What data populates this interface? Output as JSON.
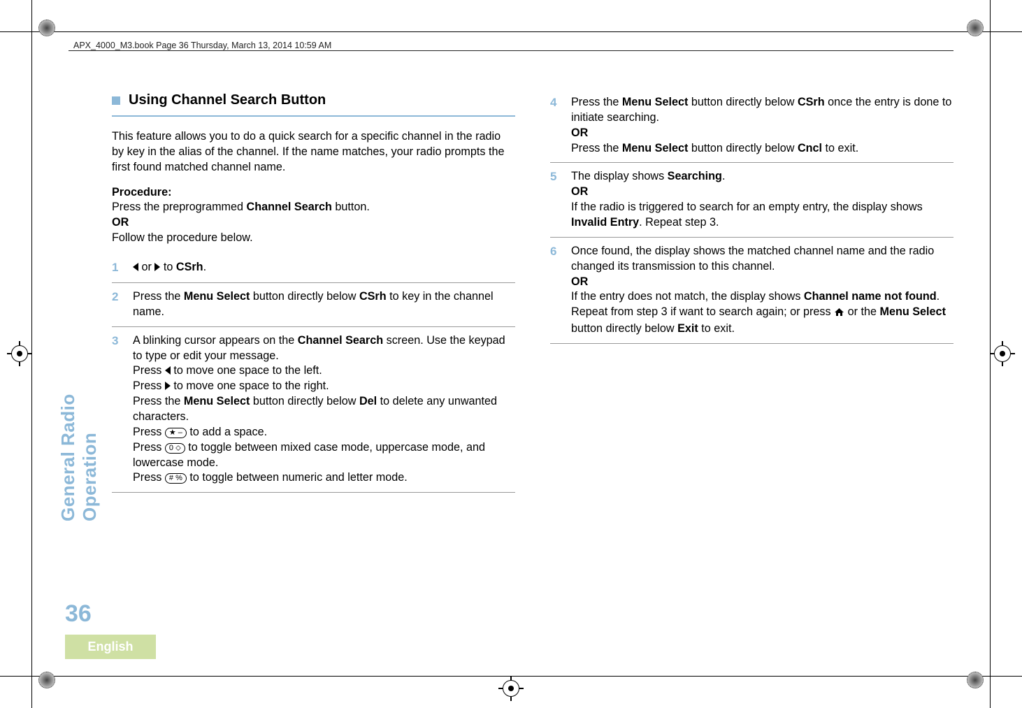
{
  "header": {
    "text": "APX_4000_M3.book  Page 36  Thursday, March 13, 2014  10:59 AM"
  },
  "sidebar": {
    "section": "General Radio Operation",
    "page": "36",
    "language": "English"
  },
  "left": {
    "title": "Using Channel Search Button",
    "intro": "This feature allows you to do a quick search for a specific channel in the radio by key in the alias of the channel. If the name matches, your radio prompts the first found matched channel name.",
    "procedure_label": "Procedure:",
    "procedure_line1a": "Press the preprogrammed ",
    "procedure_line1b": "Channel Search",
    "procedure_line1c": " button.",
    "or": "OR",
    "procedure_line2": "Follow the procedure below.",
    "step1_or": " or ",
    "step1_to": " to ",
    "step1_target": "CSrh",
    "step1_end": ".",
    "step2a": "Press the ",
    "step2b": "Menu Select",
    "step2c": " button directly below ",
    "step2d": "CSrh",
    "step2e": " to key in the channel name.",
    "step3a": "A blinking cursor appears on the ",
    "step3b": "Channel Search",
    "step3c": " screen. Use the keypad to type or edit your message.",
    "step3d": "Press ",
    "step3d2": " to move one space to the left.",
    "step3e": "Press ",
    "step3e2": " to move one space to the right.",
    "step3f1": "Press the ",
    "step3f2": "Menu Select",
    "step3f3": " button directly below ",
    "step3f4": "Del",
    "step3f5": " to delete any unwanted characters.",
    "step3g1": "Press ",
    "step3g_key": "★ –",
    "step3g2": " to add a space.",
    "step3h1": "Press ",
    "step3h_key": "0 ⬦",
    "step3h2": " to toggle between mixed case mode, uppercase mode, and lowercase mode.",
    "step3i1": "Press ",
    "step3i_key": "# %",
    "step3i2": " to toggle between numeric and letter mode."
  },
  "right": {
    "step4a": "Press the ",
    "step4b": "Menu Select",
    "step4c": " button directly below ",
    "step4d": "CSrh",
    "step4e": " once the entry is done to initiate searching.",
    "or": "OR",
    "step4f": "Press the ",
    "step4g": "Menu Select",
    "step4h": " button directly below ",
    "step4i": "Cncl",
    "step4j": " to exit.",
    "step5a": "The display shows ",
    "step5b": "Searching",
    "step5c": ".",
    "step5d": "If the radio is triggered to search for an empty entry, the display shows ",
    "step5e": "Invalid Entry",
    "step5f": ". Repeat step 3.",
    "step6a": "Once found, the display shows the matched channel name and the radio changed its transmission to this channel.",
    "step6b": "If the entry does not match, the display shows ",
    "step6c": "Channel name not found",
    "step6d": ". Repeat from step 3 if want to search again; or press ",
    "step6e": " or the ",
    "step6f": "Menu Select",
    "step6g": " button directly below ",
    "step6h": "Exit",
    "step6i": " to exit."
  },
  "nums": {
    "s1": "1",
    "s2": "2",
    "s3": "3",
    "s4": "4",
    "s5": "5",
    "s6": "6"
  }
}
